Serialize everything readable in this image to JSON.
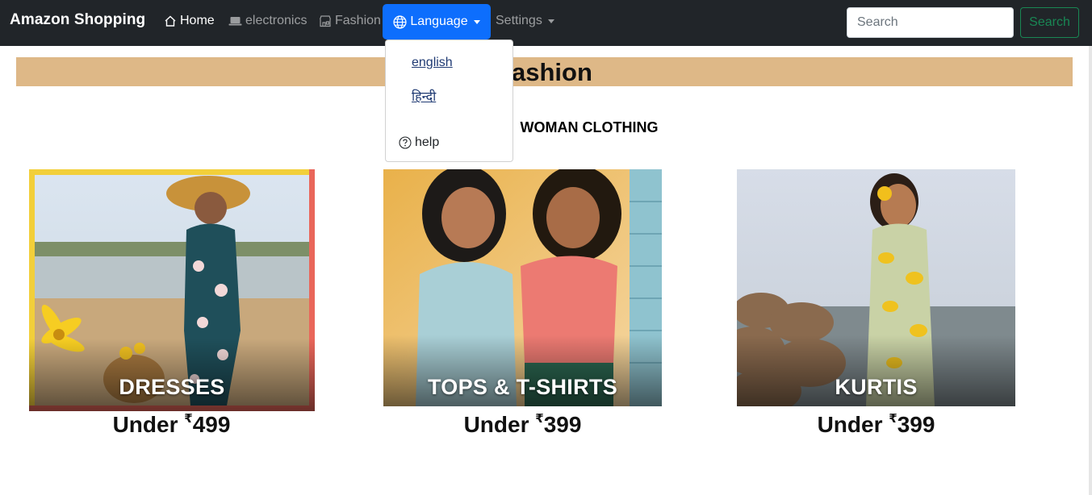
{
  "navbar": {
    "brand": "Amazon Shopping",
    "home": "Home",
    "electronics": "electronics",
    "fashion": "Fashion",
    "language": "Language",
    "settings": "Settings",
    "search_placeholder": "Search",
    "search_button": "Search"
  },
  "language_menu": {
    "english": "english",
    "hindi": "हिन्दी",
    "help": "help"
  },
  "section": {
    "title": "Fashion",
    "subheading": "WOMAN CLOTHING"
  },
  "products": [
    {
      "label": "DRESSES",
      "price_prefix": "Under ",
      "currency": "₹",
      "price": "499"
    },
    {
      "label": "TOPS & T-SHIRTS",
      "price_prefix": "Under ",
      "currency": "₹",
      "price": "399"
    },
    {
      "label": "KURTIS",
      "price_prefix": "Under ",
      "currency": "₹",
      "price": "399"
    }
  ],
  "colors": {
    "navbar_bg": "#212529",
    "language_active": "#0d6efd",
    "section_bar": "#deb887",
    "search_button": "#198754"
  }
}
